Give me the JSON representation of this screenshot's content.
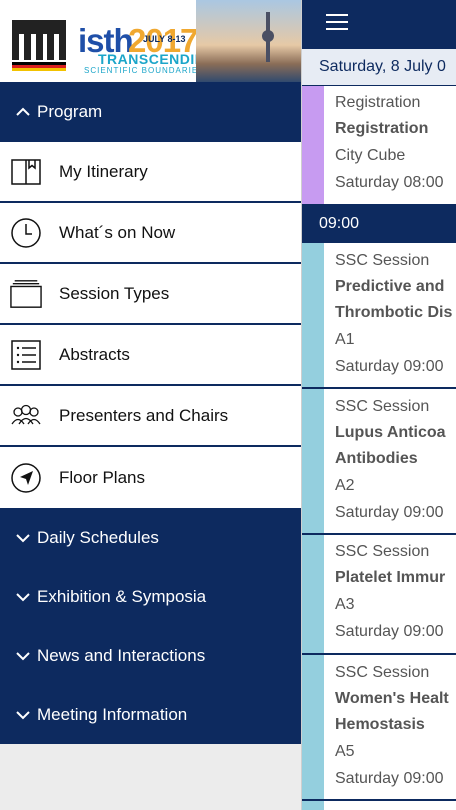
{
  "schedule": {
    "date_label": "Saturday, 8 July 0",
    "sessions_top": [
      {
        "type": "Registration",
        "title_lines": [
          "Registration"
        ],
        "room": "City Cube",
        "time": "Saturday 08:00",
        "color": "#c79bf1"
      }
    ],
    "time_header": "09:00",
    "sessions": [
      {
        "type": "SSC Session",
        "title_lines": [
          "Predictive and",
          "Thrombotic Dis"
        ],
        "room": "A1",
        "time": "Saturday 09:00",
        "color": "#94cfde"
      },
      {
        "type": "SSC Session",
        "title_lines": [
          "Lupus Anticoa",
          "Antibodies"
        ],
        "room": "A2",
        "time": "Saturday 09:00",
        "color": "#94cfde"
      },
      {
        "type": "SSC Session",
        "title_lines": [
          "Platelet Immur"
        ],
        "room": "A3",
        "time": "Saturday 09:00",
        "color": "#94cfde"
      },
      {
        "type": "SSC Session",
        "title_lines": [
          "Women's Healt",
          "Hemostasis"
        ],
        "room": "A5",
        "time": "Saturday 09:00",
        "color": "#94cfde"
      }
    ]
  },
  "logo": {
    "isth": "isth",
    "year": "2017",
    "dates": "JULY 8-13",
    "tagline": "TRANSCENDING",
    "subtagline": "SCIENTIFIC BOUNDARIES"
  },
  "menu": {
    "program_label": "Program",
    "items": [
      {
        "label": "My Itinerary",
        "icon": "book-icon"
      },
      {
        "label": "What´s on Now",
        "icon": "clock-icon"
      },
      {
        "label": "Session Types",
        "icon": "stack-icon"
      },
      {
        "label": "Abstracts",
        "icon": "list-icon"
      },
      {
        "label": "Presenters and Chairs",
        "icon": "people-icon"
      },
      {
        "label": "Floor Plans",
        "icon": "navigation-icon"
      }
    ],
    "sections": [
      {
        "label": "Daily Schedules"
      },
      {
        "label": "Exhibition & Symposia"
      },
      {
        "label": "News and Interactions"
      },
      {
        "label": "Meeting Information"
      }
    ]
  },
  "colors": {
    "primary": "#0d2a5f",
    "registration": "#c79bf1",
    "ssc_session": "#94cfde"
  }
}
